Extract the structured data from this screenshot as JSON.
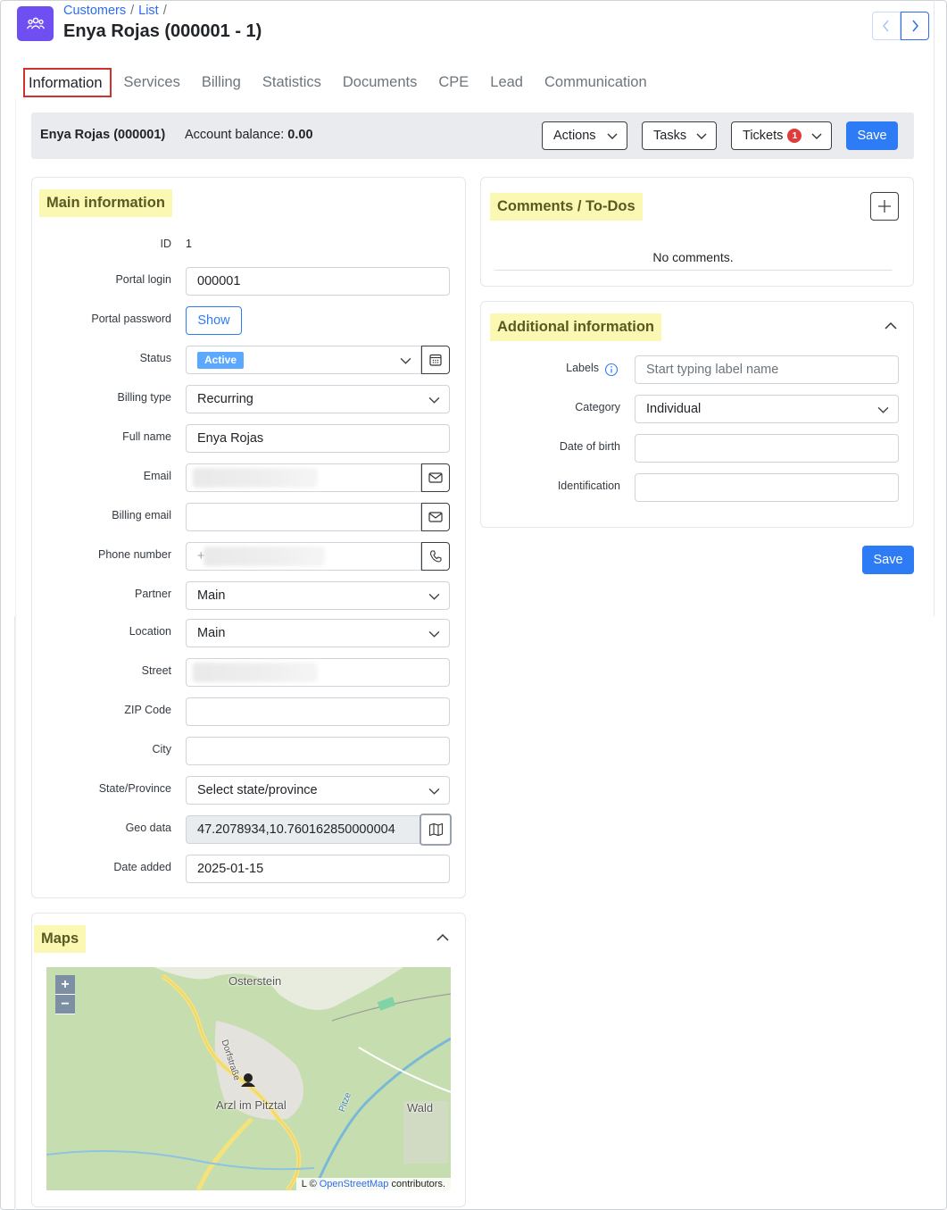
{
  "breadcrumb": [
    "Customers",
    "List"
  ],
  "title": "Enya Rojas (000001 - 1)",
  "tabs": [
    "Information",
    "Services",
    "Billing",
    "Statistics",
    "Documents",
    "CPE",
    "Lead",
    "Communication"
  ],
  "topbar": {
    "customer": "Enya Rojas (000001)",
    "balance_label": "Account balance:",
    "balance_value": "0.00",
    "actions": "Actions",
    "tasks": "Tasks",
    "tickets": "Tickets",
    "tickets_count": "1",
    "save": "Save"
  },
  "main_info": {
    "title": "Main information",
    "labels": {
      "id": "ID",
      "portal_login": "Portal login",
      "portal_password": "Portal password",
      "status": "Status",
      "billing_type": "Billing type",
      "full_name": "Full name",
      "email": "Email",
      "billing_email": "Billing email",
      "phone": "Phone number",
      "partner": "Partner",
      "location": "Location",
      "street": "Street",
      "zip": "ZIP Code",
      "city": "City",
      "state": "State/Province",
      "geo": "Geo data",
      "date_added": "Date added"
    },
    "values": {
      "id": "1",
      "portal_login": "000001",
      "show_button": "Show",
      "status": "Active",
      "billing_type": "Recurring",
      "full_name": "Enya Rojas",
      "phone_prefix": "+",
      "partner": "Main",
      "location": "Main",
      "state": "Select state/province",
      "geo": "47.2078934,10.760162850000004",
      "date_added": "2025-01-15"
    }
  },
  "comments": {
    "title": "Comments / To-Dos",
    "empty": "No comments."
  },
  "additional": {
    "title": "Additional information",
    "labels_label": "Labels",
    "labels_placeholder": "Start typing label name",
    "category_label": "Category",
    "category_value": "Individual",
    "dob_label": "Date of birth",
    "ident_label": "Identification",
    "save": "Save"
  },
  "maps": {
    "title": "Maps",
    "zoom_in": "+",
    "zoom_out": "−",
    "places": [
      "Osterstein",
      "Arzl im Pitztal",
      "Wald",
      "Dorfstraße",
      "Pitze"
    ],
    "attribution_prefix": "©",
    "attribution_link": "OpenStreetMap",
    "attribution_suffix": "contributors.",
    "attribution_l": "L"
  },
  "colors": {
    "brand": "#6f4ef2",
    "primary": "#2d7cf6",
    "highlight": "#fbf8b3",
    "tab_active_border": "#d22f2f",
    "badge_active": "#5aa8ff"
  }
}
